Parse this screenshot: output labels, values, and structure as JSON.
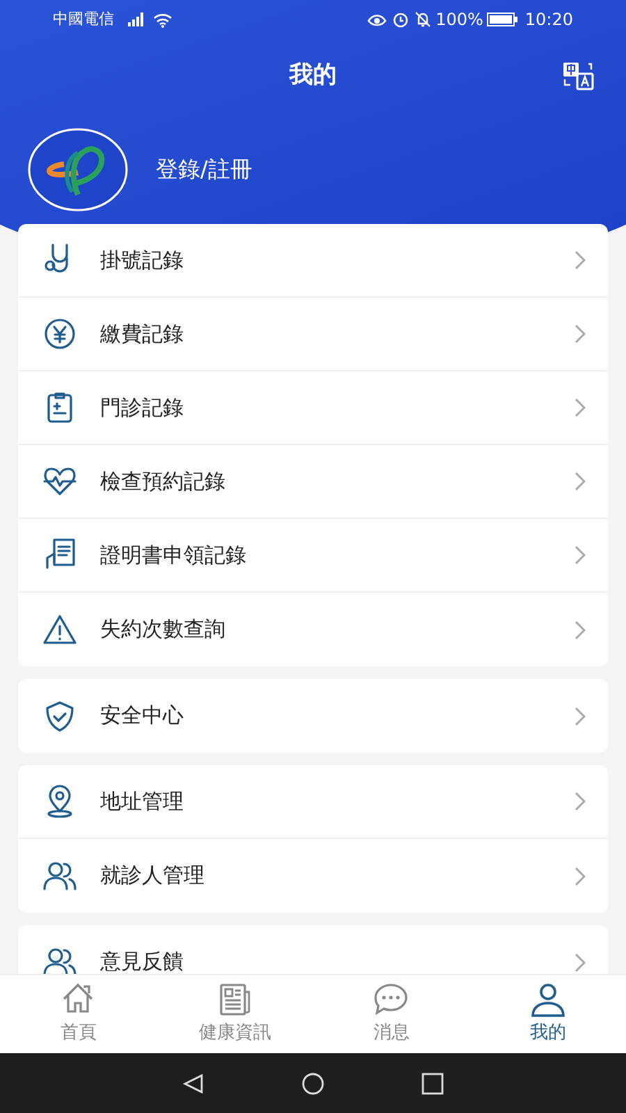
{
  "status_bar": {
    "carrier": "中國電信",
    "battery": "100%",
    "time": "10:20"
  },
  "header": {
    "title": "我的",
    "login": "登錄/註冊"
  },
  "groups": [
    {
      "items": [
        {
          "label": "掛號記錄"
        },
        {
          "label": "繳費記錄"
        },
        {
          "label": "門診記錄"
        },
        {
          "label": "檢查預約記錄"
        },
        {
          "label": "證明書申領記錄"
        },
        {
          "label": "失約次數查詢"
        }
      ]
    },
    {
      "items": [
        {
          "label": "安全中心"
        }
      ]
    },
    {
      "items": [
        {
          "label": "地址管理"
        },
        {
          "label": "就診人管理"
        }
      ]
    },
    {
      "items": [
        {
          "label": "意見反饋"
        }
      ]
    }
  ],
  "tab_bar": [
    {
      "label": "首頁",
      "selected": false
    },
    {
      "label": "健康資訊",
      "selected": false
    },
    {
      "label": "消息",
      "selected": false
    },
    {
      "label": "我的",
      "selected": true
    }
  ]
}
